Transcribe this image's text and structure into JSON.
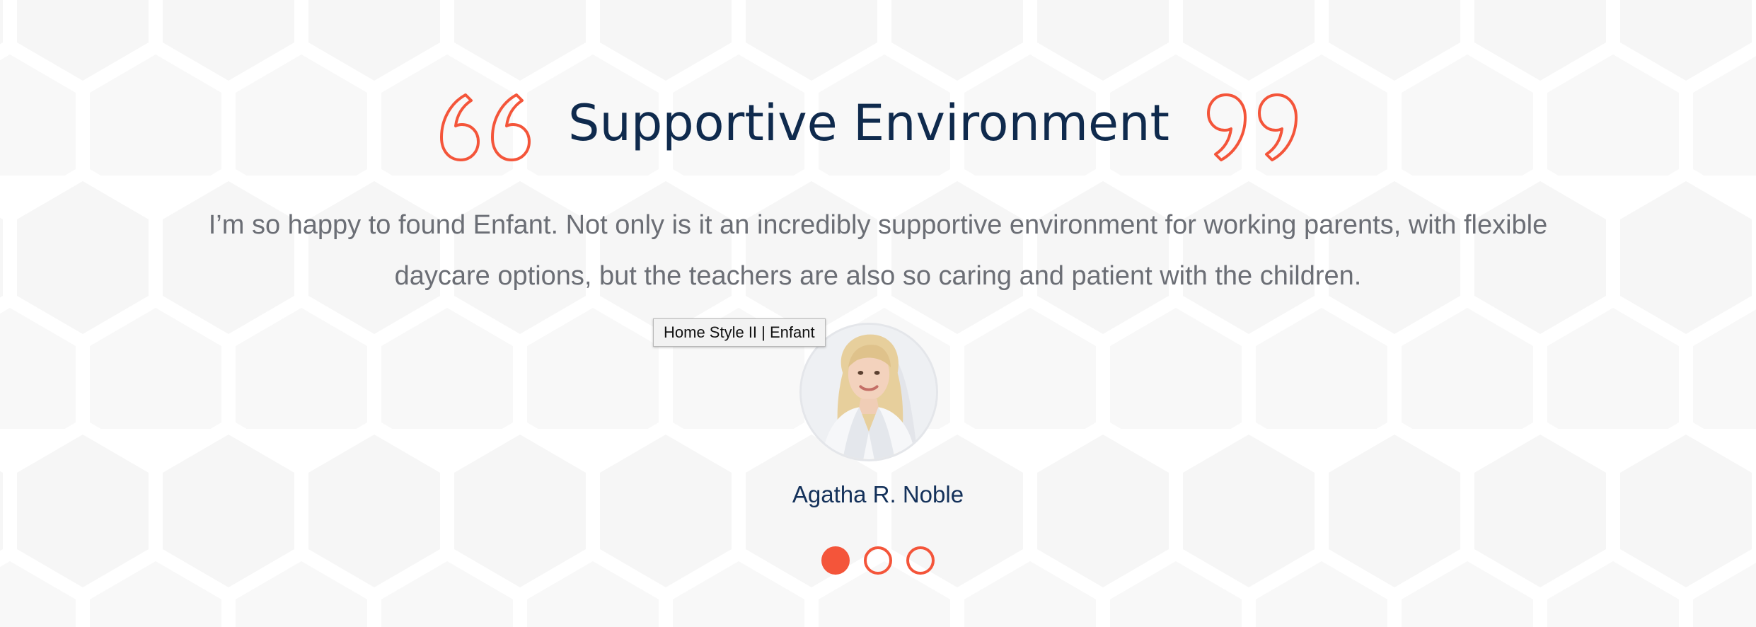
{
  "testimonial": {
    "title": "Supportive Environment",
    "quote": "I’m so happy to found Enfant. Not only is it an incredibly supportive environment for working parents, with flexible daycare options, but the teachers are also so caring and patient with the children.",
    "author": "Agatha R. Noble",
    "avatar_icon": "woman-portrait",
    "quote_icons": [
      "open-quote-icon",
      "close-quote-icon"
    ]
  },
  "tooltip": {
    "text": "Home Style II | Enfant"
  },
  "carousel": {
    "active_index": 0,
    "total": 3
  },
  "colors": {
    "accent": "#f4553a",
    "heading": "#0f2a4d",
    "body_text": "#6b6e75",
    "author": "#14315a",
    "pattern": "#f7f7f7"
  }
}
